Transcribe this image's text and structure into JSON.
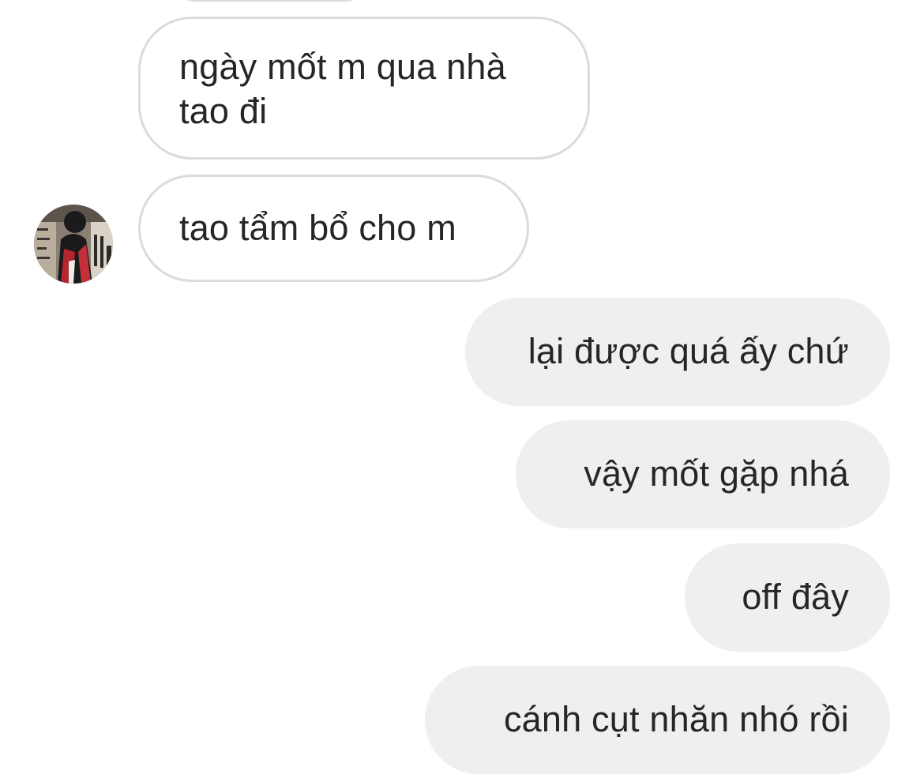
{
  "conversation": {
    "messages": [
      {
        "direction": "incoming",
        "text_lines": [
          "ngày mốt m qua nhà",
          "tao đi"
        ]
      },
      {
        "direction": "incoming",
        "text": "tao tẩm bổ cho m",
        "avatar": "profile-photo-avatar"
      },
      {
        "direction": "outgoing",
        "text": "lại được quá ấy chứ"
      },
      {
        "direction": "outgoing",
        "text": "vậy mốt gặp nhá"
      },
      {
        "direction": "outgoing",
        "text": "off đây"
      },
      {
        "direction": "outgoing",
        "text": "cánh cụt nhăn nhó rồi"
      }
    ]
  },
  "colors": {
    "background": "#ffffff",
    "incoming_border": "#dbdbdb",
    "outgoing_fill": "#efefef",
    "text": "#262626"
  }
}
